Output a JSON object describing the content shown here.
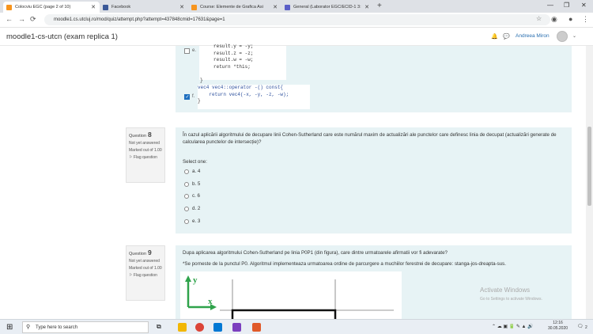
{
  "browser": {
    "tabs": [
      {
        "label": "Colocviu EGC (page 2 of 10)",
        "color": "#f7941d"
      },
      {
        "label": "Facebook",
        "color": "#3b5998"
      },
      {
        "label": "Course: Elemente de Grafica Asi",
        "color": "#f7941d"
      },
      {
        "label": "General (Laborator EGC/ECID-1 3:",
        "color": "#5b5fc7"
      }
    ],
    "new_tab": "+",
    "url": "moodle1.cs.utcluj.ro/mod/quiz/attempt.php?attempt=437848cmid=17631&page=1"
  },
  "moodle": {
    "site_name": "moodle1-cs-utcn (exam replica 1)",
    "user_name": "Andreea Miron"
  },
  "prev_question": {
    "option_e_label": "e.",
    "option_e_code": [
      "result.y = -y;",
      "result.z = -z;",
      "result.w = -w;",
      "return *this;"
    ],
    "brace_close": "}",
    "option_f_label": "f.",
    "option_f_code": [
      "vec4 vec4::operator -() const{",
      "    return vec4(-x, -y, -z, -w);",
      "}"
    ]
  },
  "q8": {
    "question_label": "Question",
    "number": "8",
    "status": "Not yet answered",
    "marked": "Marked out of 1.00",
    "flag": "Flag question",
    "text": "În cazul aplicării algoritmului de decupare linii Cohen-Sutherland care este numărul maxim de actualizări ale punctelor care definesc linia de decupat (actualizări generate de calcularea punctelor de intersecție)?",
    "select_one": "Select one:",
    "options": [
      "a. 4",
      "b. 5",
      "c. 6",
      "d. 2",
      "e. 3"
    ]
  },
  "q9": {
    "question_label": "Question",
    "number": "9",
    "status": "Not yet answered",
    "marked": "Marked out of 1.00",
    "flag": "Flag question",
    "text1": "Dupa aplicarea algoritmului Cohen-Sutherland pe linia P0P1 (din figura), care dintre urmatoarele afirmatii vor fi adevarate?",
    "text2": "*Se porneste de la punctul P0. Algoritmul implementeaza urmatoarea ordine de parcurgere a muchiilor ferestrei de decupare: stanga-jos-dreapta-sus.",
    "axis_y": "y",
    "axis_x": "x"
  },
  "watermark": {
    "title": "Activate Windows",
    "sub": "Go to Settings to activate Windows."
  },
  "taskbar": {
    "search_placeholder": "Type here to search",
    "time": "12:16",
    "date": "30.05.2020",
    "notif_count": "2"
  }
}
